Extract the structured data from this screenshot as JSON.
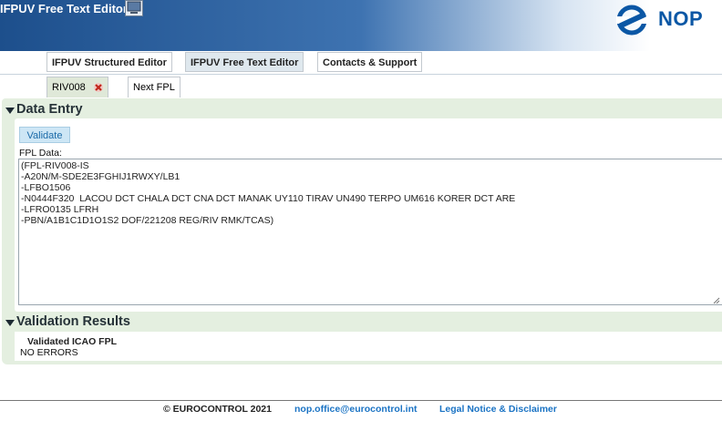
{
  "header": {
    "app_title": "IFPUV Free Text Editor",
    "logo_text": "NOP",
    "brand_color": "#0b57a5"
  },
  "nav": {
    "tabs": [
      {
        "label": "IFPUV Structured Editor",
        "active": false
      },
      {
        "label": "IFPUV Free Text Editor",
        "active": true
      },
      {
        "label": "Contacts & Support",
        "active": false
      }
    ]
  },
  "subnav": {
    "tabs": [
      {
        "label": "RIV008",
        "closable": true,
        "active": true
      },
      {
        "label": "Next FPL",
        "closable": false,
        "active": false
      }
    ]
  },
  "data_entry": {
    "title": "Data Entry",
    "validate_label": "Validate",
    "fpl_label": "FPL Data:",
    "fpl_text": "(FPL-RIV008-IS\n-A20N/M-SDE2E3FGHIJ1RWXY/LB1\n-LFBO1506\n-N0444F320  LACOU DCT CHALA DCT CNA DCT MANAK UY110 TIRAV UN490 TERPO UM616 KORER DCT ARE\n-LFRO0135 LFRH\n-PBN/A1B1C1D1O1S2 DOF/221208 REG/RIV RMK/TCAS)"
  },
  "validation": {
    "title": "Validation Results",
    "label": "Validated ICAO FPL",
    "value": "NO ERRORS"
  },
  "footer": {
    "copyright": "© EUROCONTROL 2021",
    "email": "nop.office@eurocontrol.int",
    "legal": "Legal Notice & Disclaimer"
  },
  "icons": {
    "monitor": "monitor-icon",
    "close": "close-icon",
    "collapse": "collapse-triangle-icon",
    "logo": "eurocontrol-logo-icon"
  }
}
